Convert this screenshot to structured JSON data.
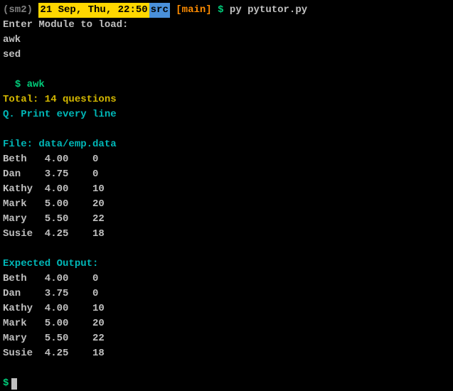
{
  "prompt": {
    "env": "(sm2)",
    "datetime": " 21 Sep, Thu, 22:50 ",
    "dir": " src ",
    "branch": "[main]",
    "symbol": "$",
    "command": "py pytutor.py"
  },
  "lines": {
    "enter_module": "Enter Module to load:",
    "awk": "awk",
    "sed": "sed",
    "input_prompt": "$ ",
    "input_value": "awk",
    "total": "Total: 14 questions",
    "question": "Q. Print every line",
    "file_label": "File: data/emp.data",
    "expected_label": "Expected Output:",
    "final_prompt": "$"
  },
  "file_data": [
    "Beth   4.00    0",
    "Dan    3.75    0",
    "Kathy  4.00    10",
    "Mark   5.00    20",
    "Mary   5.50    22",
    "Susie  4.25    18"
  ],
  "expected_output": [
    "Beth   4.00    0",
    "Dan    3.75    0",
    "Kathy  4.00    10",
    "Mark   5.00    20",
    "Mary   5.50    22",
    "Susie  4.25    18"
  ]
}
